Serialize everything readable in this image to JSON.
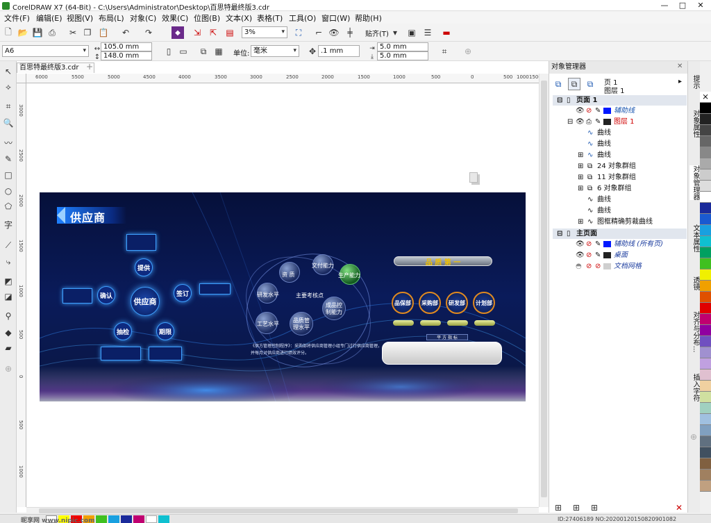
{
  "window": {
    "title": "CorelDRAW X7 (64-Bit) - C:\\Users\\Administrator\\Desktop\\百思特最终版3.cdr"
  },
  "menu": [
    "文件(F)",
    "编辑(E)",
    "视图(V)",
    "布局(L)",
    "对象(C)",
    "效果(C)",
    "位图(B)",
    "文本(X)",
    "表格(T)",
    "工具(O)",
    "窗口(W)",
    "帮助(H)"
  ],
  "toolbar": {
    "zoom": "3%",
    "snap": "贴齐(T)"
  },
  "propbar": {
    "page_size": "A6",
    "width": "105.0 mm",
    "height": "148.0 mm",
    "unit_label": "单位:",
    "unit": "毫米",
    "nudge": ".1 mm",
    "dup_x": "5.0 mm",
    "dup_y": "5.0 mm"
  },
  "doc": {
    "tab": "百思特最终版3.cdr"
  },
  "ruler": {
    "h": [
      "6000",
      "5500",
      "5000",
      "4500",
      "4000",
      "3500",
      "3000",
      "2500",
      "2000",
      "1500",
      "1000",
      "500",
      "0",
      "500",
      "1000",
      "1500"
    ],
    "v": [
      "3000",
      "2500",
      "2000",
      "1500",
      "1000",
      "500",
      "0",
      "500",
      "1000"
    ]
  },
  "design": {
    "banner": "供应商",
    "center": "供应商",
    "nodes": [
      "提供",
      "确认",
      "签订",
      "抽检",
      "期限"
    ],
    "spheres": [
      "资  质",
      "文付能力",
      "生产能力",
      "研发水平",
      "主要考核点",
      "成品控制能力",
      "工艺水平",
      "品质管理水平"
    ],
    "bottom_text_1": "《供方管理控制程序》：采购部将供应商管理小组专门过行供应商管理，",
    "bottom_text_2": "并每月对供应商进行绩效评分。",
    "quality_banner": "品 质 第 一",
    "depts": [
      "品保部",
      "采购部",
      "研发部",
      "计划部"
    ],
    "footer_title": "平 方 指 标"
  },
  "panel": {
    "title": "对象管理器",
    "page_label": "页 1",
    "layer_label": "图层 1",
    "page1": "页面 1",
    "items": [
      "辅助线",
      "图层 1",
      "曲线",
      "曲线",
      "曲线",
      "24 对象群组",
      "11 对象群组",
      "6 对象群组",
      "曲线",
      "曲线",
      "图框精确剪裁曲线"
    ],
    "master": "主页面",
    "master_items": [
      "辅助线 (所有页)",
      "桌面",
      "文档网格"
    ]
  },
  "docker_tabs": [
    "提示",
    "对象属性",
    "对象管理器",
    "文本属性",
    "透镜",
    "对齐与分布...",
    "插入字符"
  ],
  "colors": {
    "accent_blue": "#1a56b0",
    "layer_red": "#d00000",
    "master_blue": "#2040a0"
  },
  "watermark": {
    "left": "昵享网 www.nipic.com",
    "right": "ID:27406189 NO:20200120150820901082"
  }
}
